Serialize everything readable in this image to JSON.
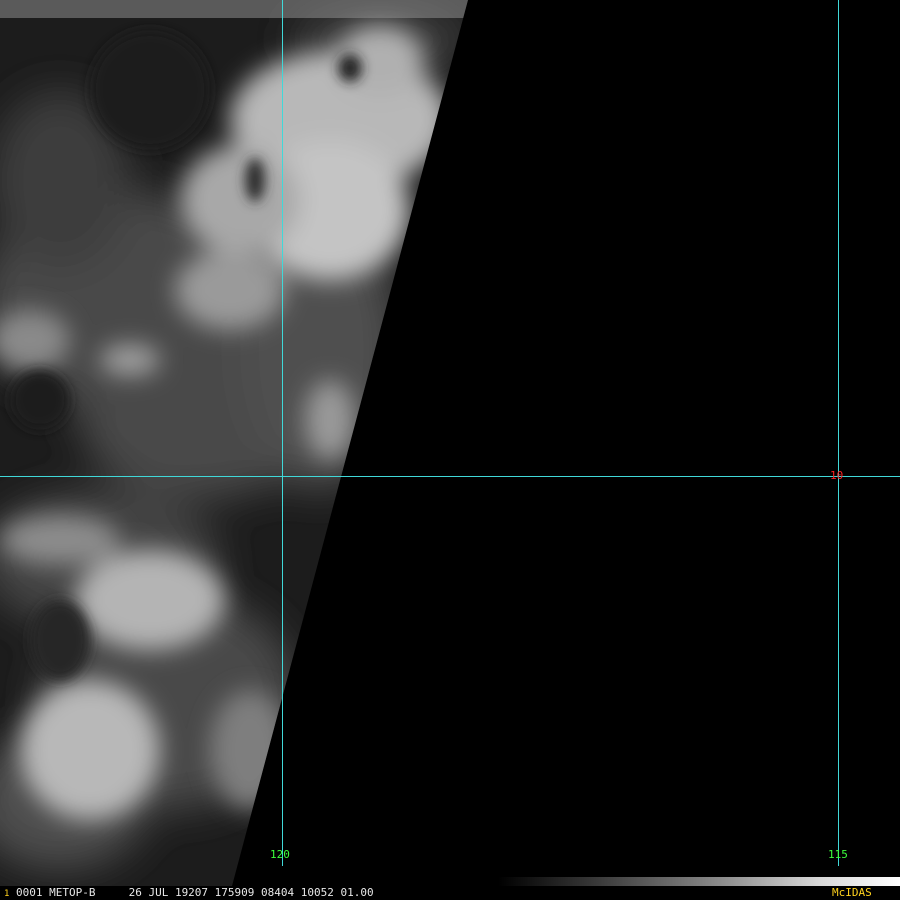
{
  "map": {
    "longitude_labels": [
      "120",
      "115"
    ],
    "latitude_labels": [
      "10"
    ],
    "grid_color": "#40d8d8",
    "longitude_label_color": "#3cff3c",
    "latitude_label_color": "#ff2020"
  },
  "status_bar": {
    "frame_marker": "1",
    "text": "0001 METOP-B     26 JUL 19207 175909 08404 10052 01.00",
    "logo": "McIDAS",
    "logo_color": "#ffd21e"
  }
}
